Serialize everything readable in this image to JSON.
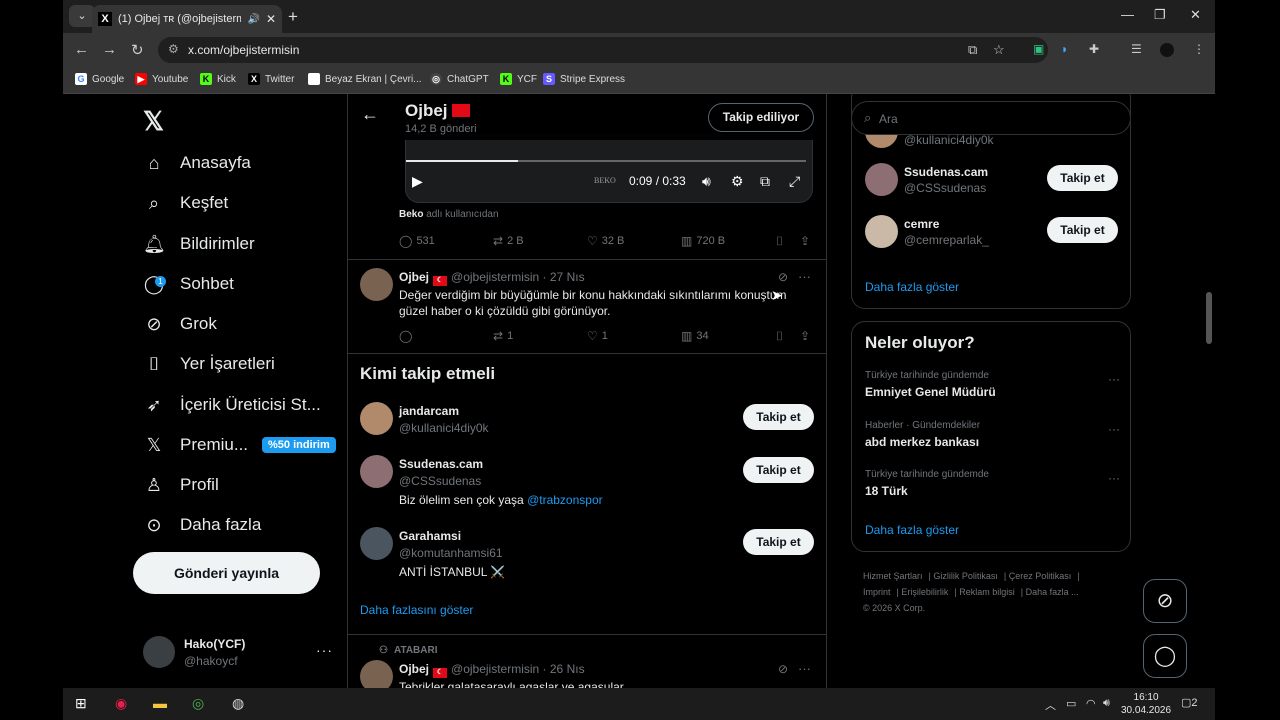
{
  "browser": {
    "tab_title": "(1) Ojbej ᴛʀ (@ojbejistermisin",
    "address": "x.com/ojbejistermisin",
    "bookmarks": [
      "Google",
      "Youtube",
      "Kick",
      "Twitter",
      "Beyaz Ekran | Çevri...",
      "ChatGPT",
      "YCF",
      "Stripe Express"
    ]
  },
  "nav": {
    "items": [
      "Anasayfa",
      "Keşfet",
      "Bildirimler",
      "Sohbet",
      "Grok",
      "Yer İşaretleri",
      "İçerik Üreticisi St...",
      "Premiu...",
      "Profil",
      "Daha fazla"
    ],
    "chat_badge": "1",
    "premium_promo": "%50 indirim",
    "post_button": "Gönderi yayınla"
  },
  "account": {
    "name": "Hako(YCF)",
    "handle": "@hakoycf"
  },
  "profile_header": {
    "name": "Ojbej",
    "post_count": "14,2 B gönderi",
    "follow_state": "Takip ediliyor"
  },
  "video": {
    "time": "0:09 / 0:33",
    "brand": "BEKO",
    "progress": 0.28
  },
  "byline": {
    "name": "Beko",
    "suffix": "adlı kullanıcıdan"
  },
  "tweet1_stats": {
    "replies": "531",
    "reposts": "2 B",
    "likes": "32 B",
    "views": "720 B"
  },
  "tweet2": {
    "name": "Ojbej",
    "meta": "@ojbejistermisin · 27 Nıs",
    "text": "Değer verdiğim bir büyüğümle bir konu hakkındaki sıkıntılarımı konuştum güzel haber o ki çözüldü gibi görünüyor.",
    "replies": "",
    "reposts": "1",
    "likes": "1",
    "views": "34"
  },
  "who_to_follow": {
    "title": "Kimi takip etmeli",
    "follow_label": "Takip et",
    "more": "Daha fazlasını göster",
    "users": [
      {
        "name": "jandarcam",
        "handle": "@kullanici4diy0k",
        "bio": "",
        "bio_link": ""
      },
      {
        "name": "Ssudenas.cam",
        "handle": "@CSSsudenas",
        "bio": "Biz ölelim sen çok yaşa",
        "bio_link": "@trabzonspor"
      },
      {
        "name": "Garahamsi",
        "handle": "@komutanhamsi61",
        "bio": "ANTİ İSTANBUL ⚔️",
        "bio_link": ""
      }
    ]
  },
  "tweet3": {
    "repost_label": "ATABARI",
    "name": "Ojbej",
    "meta": "@ojbejistermisin · 26 Nıs",
    "text": "Tebrikler galatasaraylı agaşlar ve agaşular"
  },
  "right": {
    "search_placeholder": "Ara",
    "suggest": [
      {
        "name": "",
        "handle": "@kullanici4diy0k"
      },
      {
        "name": "Ssudenas.cam",
        "handle": "@CSSsudenas"
      },
      {
        "name": "cemre",
        "handle": "@cemreparlak_"
      }
    ],
    "follow_label": "Takip et",
    "show_more": "Daha fazla göster",
    "trends_title": "Neler oluyor?",
    "trends": [
      {
        "context": "Türkiye tarihinde gündemde",
        "title": "Emniyet Genel Müdürü"
      },
      {
        "context": "Haberler · Gündemdekiler",
        "title": "abd merkez bankası"
      },
      {
        "context": "Türkiye tarihinde gündemde",
        "title": "18 Türk"
      }
    ],
    "trends_more": "Daha fazla göster",
    "footer": [
      "Hizmet Şartları",
      "Gizlilik Politikası",
      "Çerez Politikası",
      "Imprint",
      "Erişilebilirlik",
      "Reklam bilgisi",
      "Daha fazla ...",
      "© 2026 X Corp."
    ]
  },
  "taskbar": {
    "time": "16:10",
    "date": "30.04.2026",
    "notifications": "2"
  }
}
